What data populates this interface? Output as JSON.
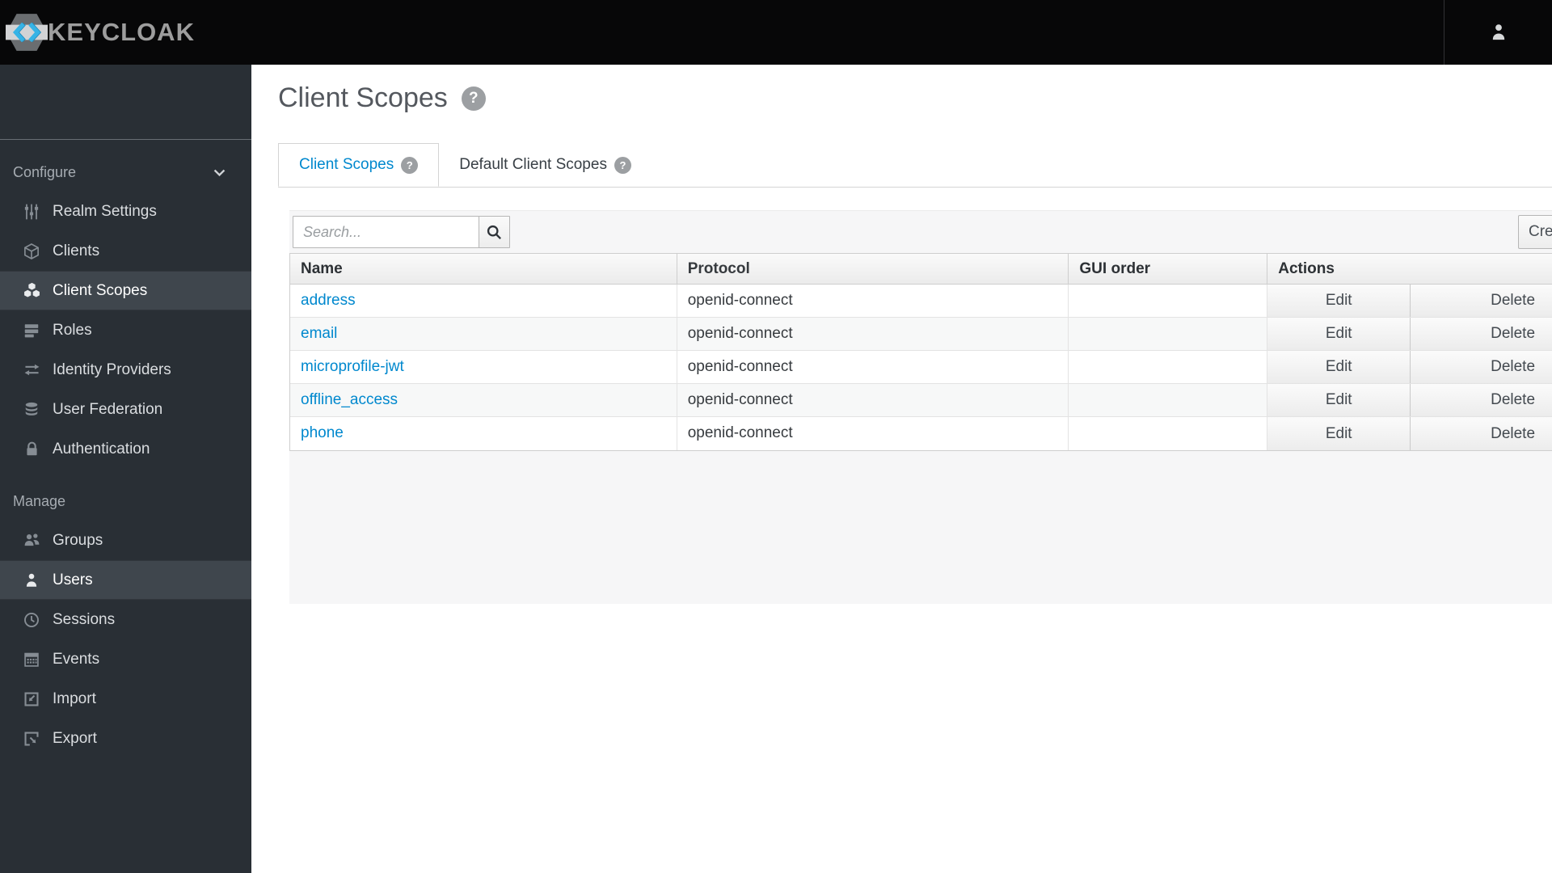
{
  "header": {
    "brand": "KEYCLOAK",
    "user_menu_icon": "user-icon"
  },
  "sidebar": {
    "sections": [
      {
        "label": "Configure",
        "collapsible": true,
        "chevron_icon": "chevron-down-icon",
        "items": [
          {
            "label": "Realm Settings",
            "icon": "sliders-icon",
            "active": false
          },
          {
            "label": "Clients",
            "icon": "cube-icon",
            "active": false
          },
          {
            "label": "Client Scopes",
            "icon": "cubes-icon",
            "active": true
          },
          {
            "label": "Roles",
            "icon": "list-icon",
            "active": false
          },
          {
            "label": "Identity Providers",
            "icon": "exchange-arrows-icon",
            "active": false
          },
          {
            "label": "User Federation",
            "icon": "database-icon",
            "active": false
          },
          {
            "label": "Authentication",
            "icon": "lock-icon",
            "active": false
          }
        ]
      },
      {
        "label": "Manage",
        "collapsible": false,
        "items": [
          {
            "label": "Groups",
            "icon": "group-icon",
            "active": false
          },
          {
            "label": "Users",
            "icon": "user-icon",
            "active": true
          },
          {
            "label": "Sessions",
            "icon": "clock-icon",
            "active": false
          },
          {
            "label": "Events",
            "icon": "calendar-icon",
            "active": false
          },
          {
            "label": "Import",
            "icon": "import-icon",
            "active": false
          },
          {
            "label": "Export",
            "icon": "export-icon",
            "active": false
          }
        ]
      }
    ]
  },
  "main": {
    "title": "Client Scopes",
    "title_help_icon": "help-icon",
    "tabs": [
      {
        "label": "Client Scopes",
        "active": true,
        "help_icon": "help-icon"
      },
      {
        "label": "Default Client Scopes",
        "active": false,
        "help_icon": "help-icon"
      }
    ],
    "toolbar": {
      "search_placeholder": "Search...",
      "search_icon": "search-icon",
      "create_label": "Create"
    },
    "table": {
      "columns": [
        "Name",
        "Protocol",
        "GUI order",
        "Actions"
      ],
      "rows": [
        {
          "name": "address",
          "protocol": "openid-connect",
          "gui_order": "",
          "actions": [
            "Edit",
            "Delete"
          ]
        },
        {
          "name": "email",
          "protocol": "openid-connect",
          "gui_order": "",
          "actions": [
            "Edit",
            "Delete"
          ]
        },
        {
          "name": "microprofile-jwt",
          "protocol": "openid-connect",
          "gui_order": "",
          "actions": [
            "Edit",
            "Delete"
          ]
        },
        {
          "name": "offline_access",
          "protocol": "openid-connect",
          "gui_order": "",
          "actions": [
            "Edit",
            "Delete"
          ]
        },
        {
          "name": "phone",
          "protocol": "openid-connect",
          "gui_order": "",
          "actions": [
            "Edit",
            "Delete"
          ]
        }
      ]
    }
  },
  "icons": {
    "help_glyph": "?"
  },
  "colors": {
    "accent": "#0088ce",
    "link": "#0088ce",
    "navbar_bg": "#070708",
    "sidebar_bg": "#292f35",
    "sidebar_active_bg": "#3f464d",
    "panel_bg": "#f6f6f7",
    "logo_blue": "#36b3e6"
  }
}
